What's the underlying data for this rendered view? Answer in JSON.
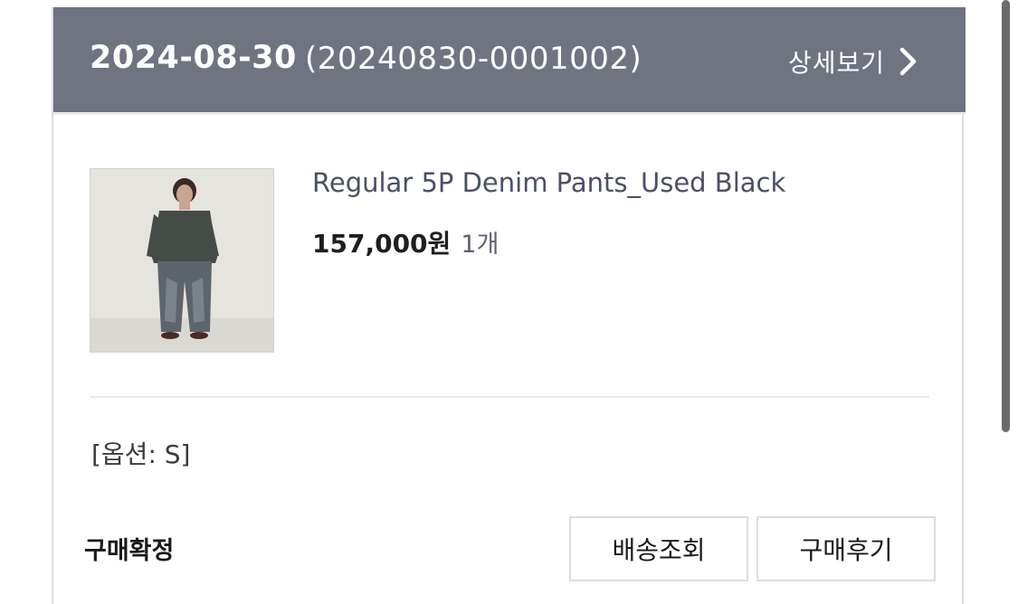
{
  "order": {
    "date": "2024-08-30",
    "number": "(20240830-0001002)",
    "detail_label": "상세보기"
  },
  "product": {
    "name": "Regular 5P Denim Pants_Used Black",
    "price": "157,000원",
    "quantity": "1개",
    "option": "[옵션: S]"
  },
  "footer": {
    "status": "구매확정",
    "tracking_label": "배송조회",
    "review_label": "구매후기"
  },
  "icons": {
    "detail_chevron": "chevron-right-icon"
  },
  "colors": {
    "header_background": "#6f7480",
    "product_name": "#4a5166"
  },
  "scrollbar": {
    "visible_fraction": 0.85
  }
}
